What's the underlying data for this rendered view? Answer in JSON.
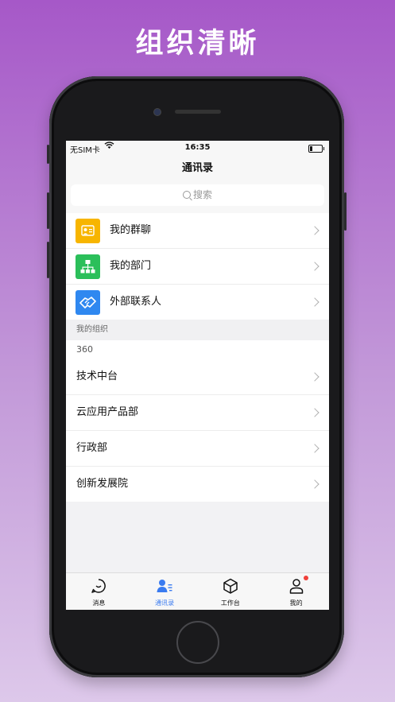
{
  "headline": "组织清晰",
  "status_bar": {
    "carrier": "无SIM卡",
    "time": "16:35"
  },
  "nav": {
    "title": "通讯录"
  },
  "search": {
    "placeholder": "搜索"
  },
  "quick_items": [
    {
      "label": "我的群聊",
      "icon": "group-chat-icon",
      "color": "#f7b500"
    },
    {
      "label": "我的部门",
      "icon": "org-chart-icon",
      "color": "#2bbf5a"
    },
    {
      "label": "外部联系人",
      "icon": "handshake-icon",
      "color": "#2f88f0"
    }
  ],
  "org_section": {
    "header": "我的组织",
    "org_name": "360",
    "departments": [
      {
        "label": "技术中台"
      },
      {
        "label": "云应用产品部"
      },
      {
        "label": "行政部"
      },
      {
        "label": "创新发展院"
      }
    ]
  },
  "tabs": [
    {
      "label": "消息",
      "icon": "message-bubble-icon"
    },
    {
      "label": "通讯录",
      "icon": "contacts-icon",
      "active": true,
      "color": "#3a7bf0"
    },
    {
      "label": "工作台",
      "icon": "cube-icon"
    },
    {
      "label": "我的",
      "icon": "person-icon",
      "badge": true
    }
  ]
}
